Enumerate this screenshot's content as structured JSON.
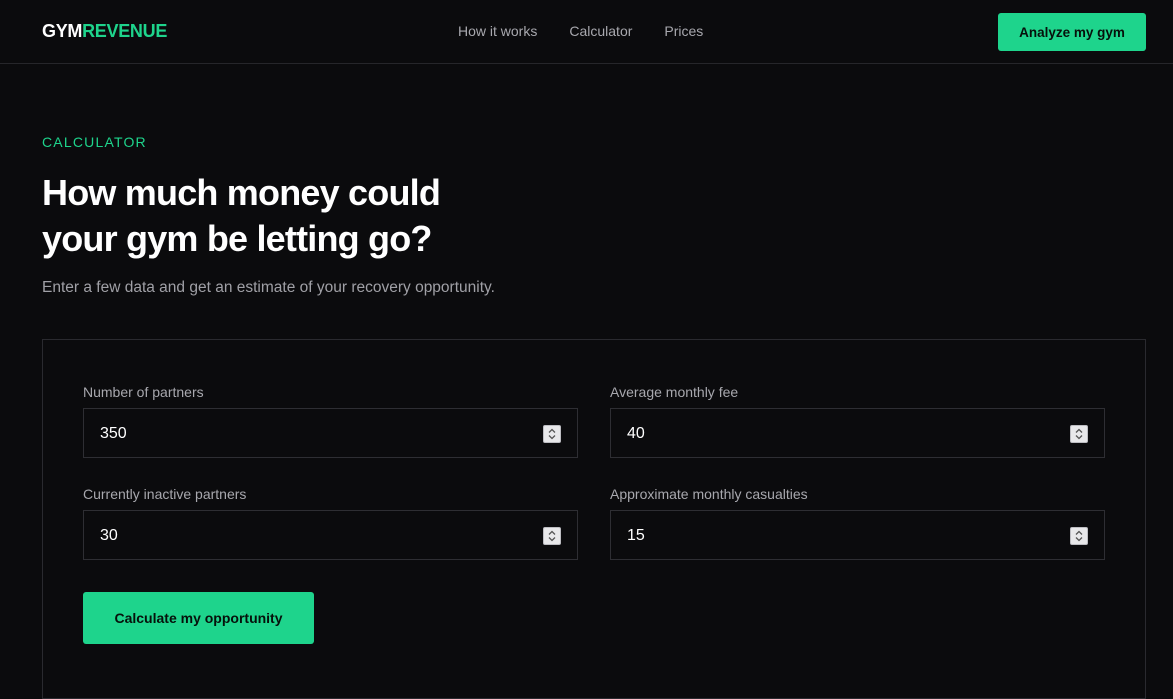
{
  "header": {
    "logo_part1": "GYM",
    "logo_part2": "REVENUE",
    "nav": [
      "How it works",
      "Calculator",
      "Prices"
    ],
    "cta": "Analyze my gym"
  },
  "hero": {
    "eyebrow": "CALCULATOR",
    "title_line1": "How much money could",
    "title_line2": "your gym be letting go?",
    "subtitle": "Enter a few data and get an estimate of your recovery opportunity."
  },
  "calculator": {
    "fields": [
      {
        "label": "Number of partners",
        "value": "350"
      },
      {
        "label": "Average monthly fee",
        "value": "40"
      },
      {
        "label": "Currently inactive partners",
        "value": "30"
      },
      {
        "label": "Approximate monthly casualties",
        "value": "15"
      }
    ],
    "submit": "Calculate my opportunity"
  },
  "colors": {
    "accent": "#1ed48c",
    "background": "#0b0b0d",
    "muted_text": "#a8a8ae",
    "border": "#2a2a2f"
  }
}
